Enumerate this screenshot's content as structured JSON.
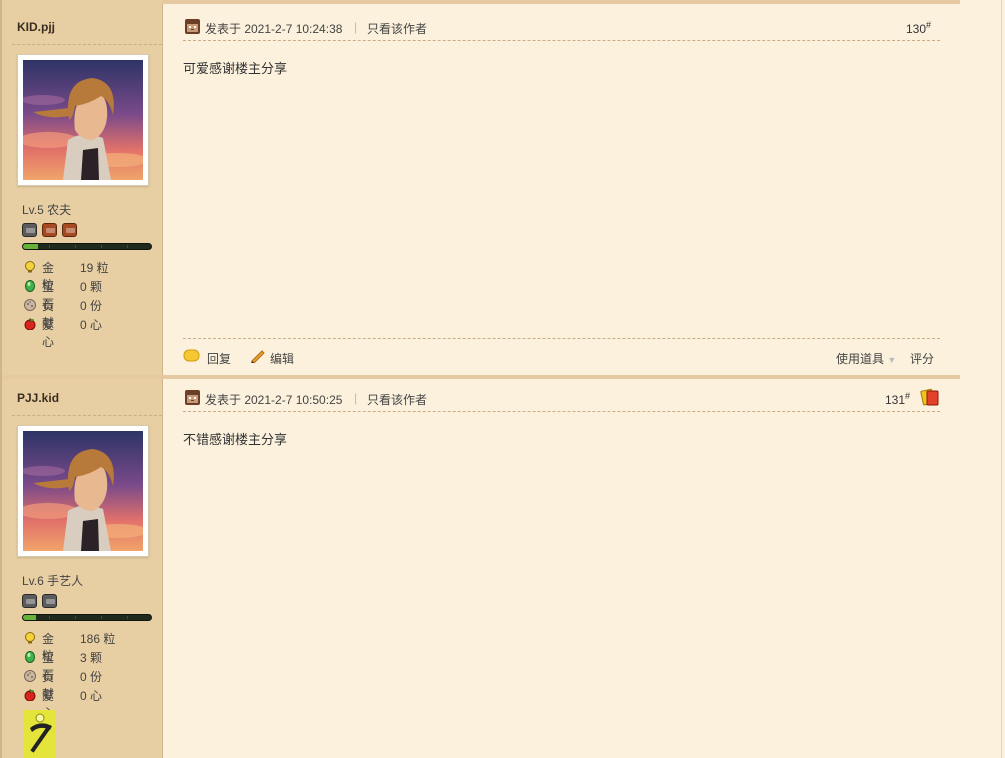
{
  "posts": [
    {
      "username": "KID.pjj",
      "level": "Lv.5 农夫",
      "badges": [
        "grey",
        "brown",
        "brown"
      ],
      "progress": 0.12,
      "stats": [
        {
          "icon": "gold-bulb-icon",
          "label": "金粒",
          "value": "19 粒"
        },
        {
          "icon": "gem-icon",
          "label": "宝石",
          "value": "0 颗"
        },
        {
          "icon": "contribution-icon",
          "label": "贡献",
          "value": "0 份"
        },
        {
          "icon": "apple-heart-icon",
          "label": "爱心",
          "value": "0 心"
        }
      ],
      "posted_at": "发表于 2021-2-7 10:24:38",
      "author_only": "只看该作者",
      "floor": "130",
      "floor_mark": "#",
      "content": "可爱感谢楼主分享",
      "reply_label": "回复",
      "edit_label": "编辑",
      "use_item_label": "使用道具",
      "rate_label": "评分"
    },
    {
      "username": "PJJ.kid",
      "level": "Lv.6 手艺人",
      "badges": [
        "grey",
        "grey"
      ],
      "progress": 0.1,
      "stats": [
        {
          "icon": "gold-bulb-icon",
          "label": "金粒",
          "value": "186 粒"
        },
        {
          "icon": "gem-icon",
          "label": "宝石",
          "value": "3 颗"
        },
        {
          "icon": "contribution-icon",
          "label": "贡献",
          "value": "0 份"
        },
        {
          "icon": "apple-heart-icon",
          "label": "爱心",
          "value": "0 心"
        }
      ],
      "posted_at": "发表于 2021-2-7 10:50:25",
      "author_only": "只看该作者",
      "floor": "131",
      "floor_mark": "#",
      "content": "不错感谢楼主分享",
      "medal_icon": "pickaxe-medal-icon"
    }
  ],
  "colors": {
    "background": "#fbf1dd",
    "sidebar": "#e8cfa3",
    "separator": "#e4c9a1"
  }
}
